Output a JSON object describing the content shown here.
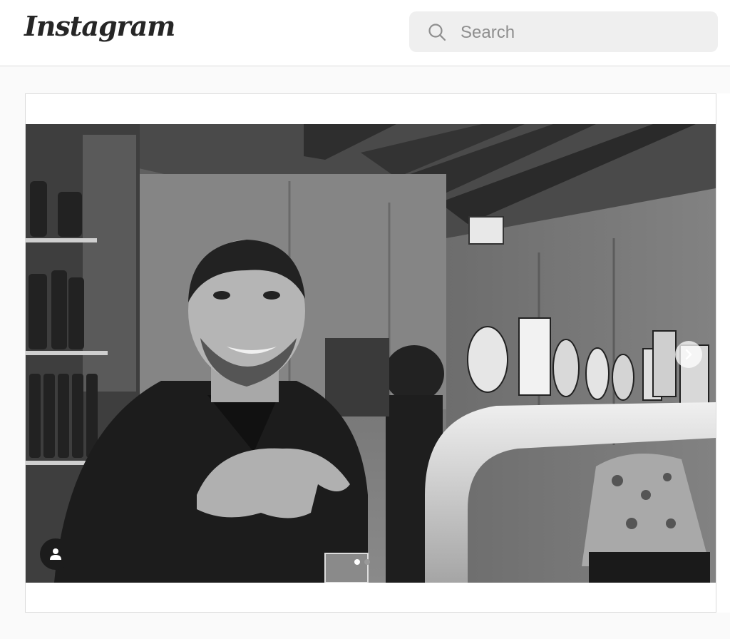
{
  "header": {
    "logo_text": "Instagram",
    "search": {
      "placeholder": "Search",
      "icon": "search-icon"
    }
  },
  "post": {
    "carousel": {
      "slide_count": 2,
      "active_index": 0,
      "next_icon": "chevron-right-icon",
      "user_tag_icon": "person-icon"
    }
  },
  "colors": {
    "topbar_bg": "#ffffff",
    "page_bg": "#fafafa",
    "border": "#dbdbdb",
    "search_bg": "#efefef",
    "text": "#262626",
    "placeholder": "#8e8e8e"
  }
}
